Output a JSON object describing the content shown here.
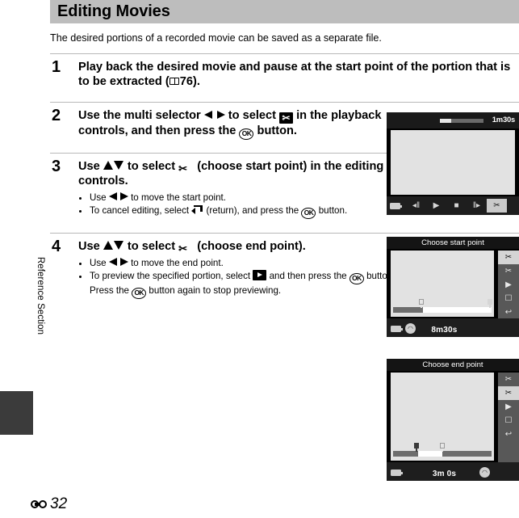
{
  "side_tab": {
    "label": "Reference Section"
  },
  "folio": {
    "mark": "reference-mark",
    "number": "32"
  },
  "chapter": {
    "title": "Editing Movies"
  },
  "intro": "The desired portions of a recorded movie can be saved as a separate file.",
  "steps": [
    {
      "number": "1",
      "headline_parts": {
        "a": "Play back the desired movie and pause at the start point of the portion that is to be extracted (",
        "b": "76)."
      }
    },
    {
      "number": "2",
      "headline_parts": {
        "a": "Use the multi selector ",
        "b": " to select ",
        "c": " in the playback controls, and then press the ",
        "d": " button."
      }
    },
    {
      "number": "3",
      "headline_parts": {
        "a": "Use ",
        "b": " to select ",
        "c": " (choose start point) in the editing controls."
      },
      "bullets": [
        {
          "a": "Use ",
          "b": " to move the start point."
        },
        {
          "a": "To cancel editing, select ",
          "b": " (return), and press the ",
          "c": " button."
        }
      ]
    },
    {
      "number": "4",
      "headline_parts": {
        "a": "Use ",
        "b": " to select ",
        "c": " (choose end point)."
      },
      "bullets": [
        {
          "a": "Use ",
          "b": " to move the end point."
        },
        {
          "a": "To preview the specified portion, select ",
          "b": " and then press the ",
          "c": " button. Press the ",
          "d": " button again to stop previewing."
        }
      ]
    }
  ],
  "screens": {
    "playback": {
      "name": "movie-playback-screen",
      "time": "1m30s",
      "progress_percent": 26,
      "controls": [
        {
          "name": "rewind-button",
          "glyph": "◂‖",
          "selected": false
        },
        {
          "name": "play-button",
          "glyph": "▶",
          "selected": false
        },
        {
          "name": "stop-button",
          "glyph": "■",
          "selected": false
        },
        {
          "name": "advance-button",
          "glyph": "‖▸",
          "selected": false
        },
        {
          "name": "edit-movie-button",
          "glyph": "✂",
          "selected": true
        }
      ]
    },
    "start_point": {
      "name": "choose-start-point-screen",
      "title": "Choose start point",
      "time": "8m30s",
      "rail": [
        {
          "name": "choose-start-point-icon",
          "glyph": "✂",
          "selected": true
        },
        {
          "name": "choose-end-point-icon",
          "glyph": "✂",
          "selected": false
        },
        {
          "name": "preview-icon",
          "glyph": "▶",
          "selected": false
        },
        {
          "name": "save-icon",
          "glyph": "☐",
          "selected": false
        },
        {
          "name": "return-icon",
          "glyph": "↩",
          "selected": false
        }
      ],
      "timeline": {
        "start_percent": 30,
        "end_percent": 100
      }
    },
    "end_point": {
      "name": "choose-end-point-screen",
      "title": "Choose end point",
      "time": "3m  0s",
      "rail": [
        {
          "name": "choose-start-point-icon",
          "glyph": "✂",
          "selected": false
        },
        {
          "name": "choose-end-point-icon",
          "glyph": "✂",
          "selected": true
        },
        {
          "name": "preview-icon",
          "glyph": "▶",
          "selected": false
        },
        {
          "name": "save-icon",
          "glyph": "☐",
          "selected": false
        },
        {
          "name": "return-icon",
          "glyph": "↩",
          "selected": false
        }
      ],
      "timeline": {
        "start_percent": 25,
        "end_percent": 50
      }
    }
  }
}
